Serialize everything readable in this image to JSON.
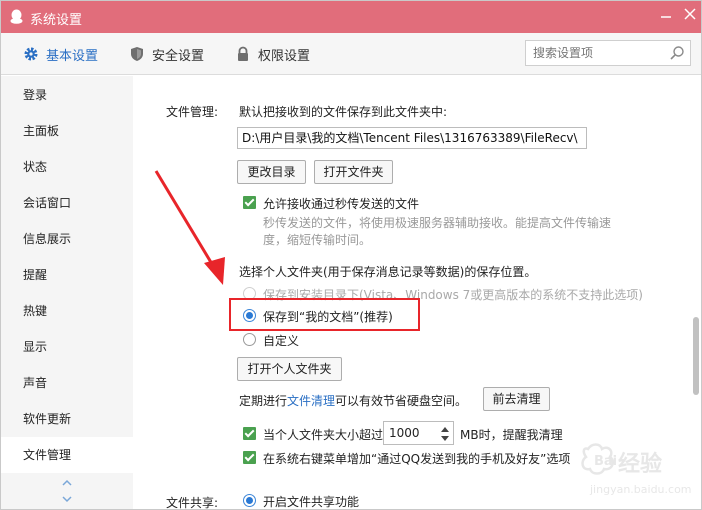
{
  "window": {
    "title": "系统设置"
  },
  "tabs": [
    {
      "label": "基本设置"
    },
    {
      "label": "安全设置"
    },
    {
      "label": "权限设置"
    }
  ],
  "search": {
    "placeholder": "搜索设置项"
  },
  "sidebar": {
    "items": [
      {
        "label": "登录"
      },
      {
        "label": "主面板"
      },
      {
        "label": "状态"
      },
      {
        "label": "会话窗口"
      },
      {
        "label": "信息展示"
      },
      {
        "label": "提醒"
      },
      {
        "label": "热键"
      },
      {
        "label": "显示"
      },
      {
        "label": "声音"
      },
      {
        "label": "软件更新"
      },
      {
        "label": "文件管理"
      }
    ],
    "active": "文件管理"
  },
  "file_management": {
    "section_label": "文件管理:",
    "desc": "默认把接收到的文件保存到此文件夹中:",
    "path": "D:\\用户目录\\我的文档\\Tencent Files\\1316763389\\FileRecv\\",
    "change_dir_button": "更改目录",
    "open_folder_button": "打开文件夹",
    "allow_instant_label": "允许接收通过秒传发送的文件",
    "instant_note_line1": "秒传发送的文件，将使用极速服务器辅助接收。能提高文件传输速",
    "instant_note_line2": "度，缩短传输时间。",
    "personal_folder_desc": "选择个人文件夹(用于保存消息记录等数据)的保存位置。",
    "option_install_dir": "保存到安装目录下(Vista、Windows 7或更高版本的系统不支持此选项)",
    "option_my_docs": "保存到“我的文档”(推荐)",
    "option_custom": "自定义",
    "open_personal_button": "打开个人文件夹",
    "cleanup_prefix": "定期进行",
    "cleanup_link": "文件清理",
    "cleanup_suffix": "可以有效节省硬盘空间。",
    "go_cleanup_button": "前去清理",
    "size_prefix": "当个人文件夹大小超过",
    "size_value": "1000",
    "size_suffix": "MB时，提醒我清理",
    "context_menu_label": "在系统右键菜单增加“通过QQ发送到我的手机及好友”选项"
  },
  "file_share": {
    "section_label": "文件共享:",
    "enable_label": "开启文件共享功能"
  },
  "watermark": {
    "text": "经验",
    "sub": "jingyan.baidu.com"
  },
  "colors": {
    "titlebar": "#e16d7b",
    "accent": "#2a6fc4",
    "check": "#4aa14f",
    "annotation": "#e8252a"
  }
}
